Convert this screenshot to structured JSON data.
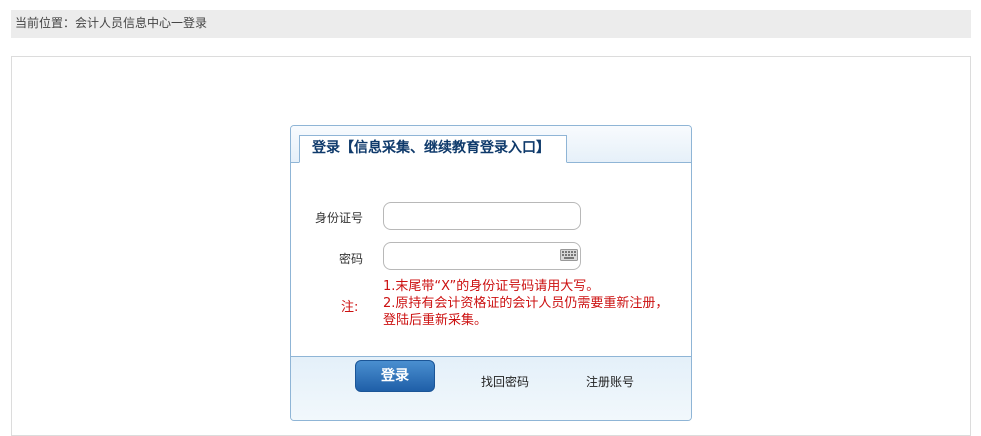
{
  "breadcrumb": {
    "text": "当前位置：会计人员信息中心一登录"
  },
  "login": {
    "tab_title": "登录【信息采集、继续教育登录入口】",
    "id_label": "身份证号",
    "id_value": "",
    "password_label": "密码",
    "password_value": "",
    "note_label": "注:",
    "notes": [
      "1.末尾带“X”的身份证号码请用大写。",
      "2.原持有会计资格证的会计人员仍需要重新注册，",
      "登陆后重新采集。"
    ],
    "login_button": "登录",
    "forgot_password": "找回密码",
    "register": "注册账号"
  },
  "colors": {
    "accent": "#1f5fa8",
    "note": "#cc1111",
    "border": "#8fb5d6"
  },
  "icons": {
    "keyboard": "keyboard-icon"
  }
}
